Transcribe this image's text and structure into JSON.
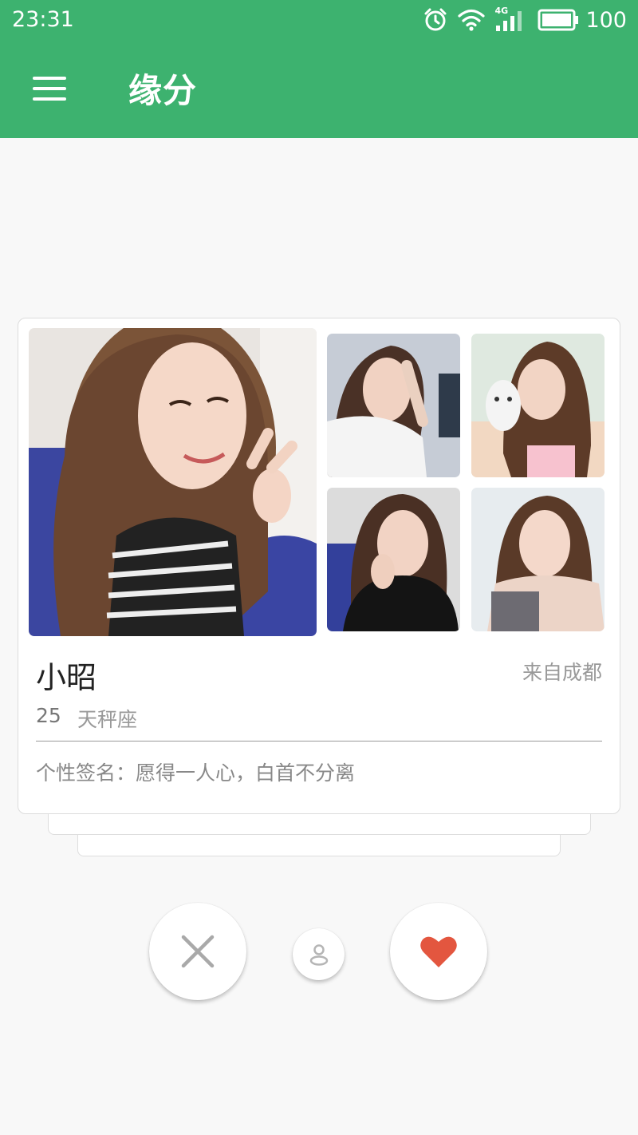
{
  "status_bar": {
    "time": "23:31",
    "network": "4G",
    "battery": "100",
    "icons": [
      "alarm-icon",
      "wifi-icon",
      "signal-icon",
      "battery-icon"
    ]
  },
  "app_bar": {
    "title": "缘分",
    "menu_icon": "menu-icon"
  },
  "colors": {
    "primary": "#3db26f",
    "like": "#e3563f",
    "background": "#f8f8f8"
  },
  "profile": {
    "name": "小昭",
    "location": "来自成都",
    "age": "25",
    "zodiac": "天秤座",
    "signature": "个性签名：愿得一人心，白首不分离",
    "photos": [
      "main-photo",
      "photo-1",
      "photo-2",
      "photo-3",
      "photo-4"
    ]
  },
  "actions": {
    "dislike_icon": "close-icon",
    "profile_icon": "person-icon",
    "like_icon": "heart-icon"
  }
}
